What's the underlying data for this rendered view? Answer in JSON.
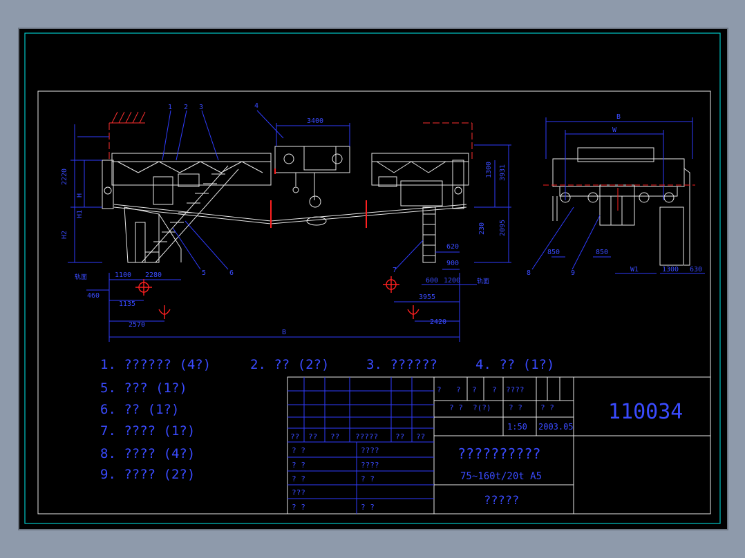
{
  "colors": {
    "page_background": "#8e9aab",
    "sheet": "#000000",
    "border_cyan": "#00c8c8",
    "frame_white": "#e8e8e8",
    "dimension_blue": "#2f3cff",
    "centerline_red": "#ff2020"
  },
  "dimensions": {
    "top_span": "3400",
    "left_h1": "2220",
    "left_h": "H",
    "left_h2": "H1",
    "left_h3": "H2",
    "right_h1": "3931",
    "right_h2": "2095",
    "right_small_1": "230",
    "right_small_2": "1300",
    "bottom_1100": "1100",
    "bottom_2280": "2280",
    "bottom_460": "460",
    "bottom_1135": "1135",
    "bottom_2570": "2570",
    "bottom_b": "B",
    "right_900": "900",
    "right_620": "620",
    "right_600": "600",
    "right_1200": "1200",
    "right_3955": "3955",
    "right_2420": "2420",
    "side_b": "B",
    "side_w": "W",
    "side_850a": "850",
    "side_850b": "850",
    "side_w1": "W1",
    "side_1300": "1300",
    "side_630": "630",
    "rail_left": "轨面",
    "rail_right": "轨面"
  },
  "callouts": [
    "1",
    "2",
    "3",
    "4",
    "5",
    "6",
    "7",
    "8",
    "9"
  ],
  "parts_list": [
    "1.  ?????? (4?)",
    "2.  ?? (2?)",
    "3.  ??????",
    "4.  ?? (1?)",
    "5.  ??? (1?)",
    "6.  ??  (1?)",
    "7.  ????  (1?)",
    "8.  ????  (4?)",
    "9.  ????  (2?)"
  ],
  "title_block": {
    "drawing_number": "110034",
    "title": "??????????",
    "spec": "75~160t/20t  A5",
    "subtitle": "?????",
    "scale": "1:50",
    "date": "2003.05",
    "stage_row": [
      "?",
      "?",
      "?",
      "?",
      "????"
    ],
    "weight_row": [
      "? ?",
      "?(?)",
      "? ?",
      "? ?"
    ],
    "header_row": [
      "??",
      "??",
      "??",
      "?????",
      "??",
      "??"
    ],
    "sign_left": [
      "? ?",
      "? ?",
      "? ?",
      "???",
      "? ?"
    ],
    "sign_mid": [
      "????",
      "????",
      "? ?",
      "? ?"
    ]
  }
}
